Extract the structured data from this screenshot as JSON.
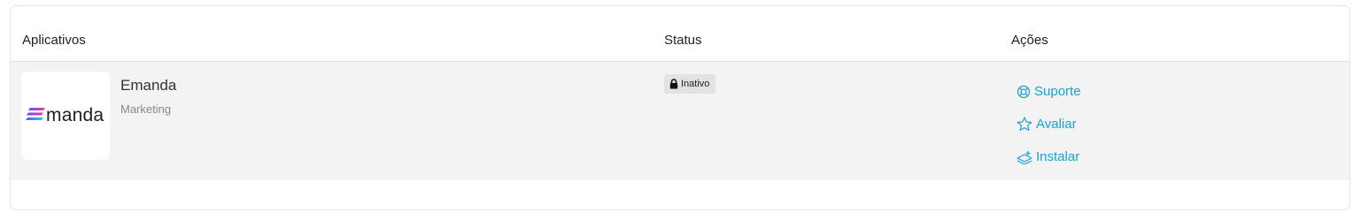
{
  "table": {
    "headers": {
      "apps": "Aplicativos",
      "status": "Status",
      "actions": "Ações"
    },
    "rows": [
      {
        "logo_text": "manda",
        "name": "Emanda",
        "category": "Marketing",
        "status": "Inativo",
        "status_icon": "lock-icon",
        "actions": [
          {
            "label": "Suporte",
            "icon": "support-lifebuoy-icon"
          },
          {
            "label": "Avaliar",
            "icon": "star-icon"
          },
          {
            "label": "Instalar",
            "icon": "install-stack-icon"
          }
        ]
      }
    ]
  },
  "colors": {
    "link": "#1a9fd6",
    "row_bg": "#f3f3f3",
    "badge_bg": "#e2e2e2",
    "logo_gradient": [
      "#7b3ff2",
      "#e23fa8",
      "#2ec5f0"
    ]
  }
}
